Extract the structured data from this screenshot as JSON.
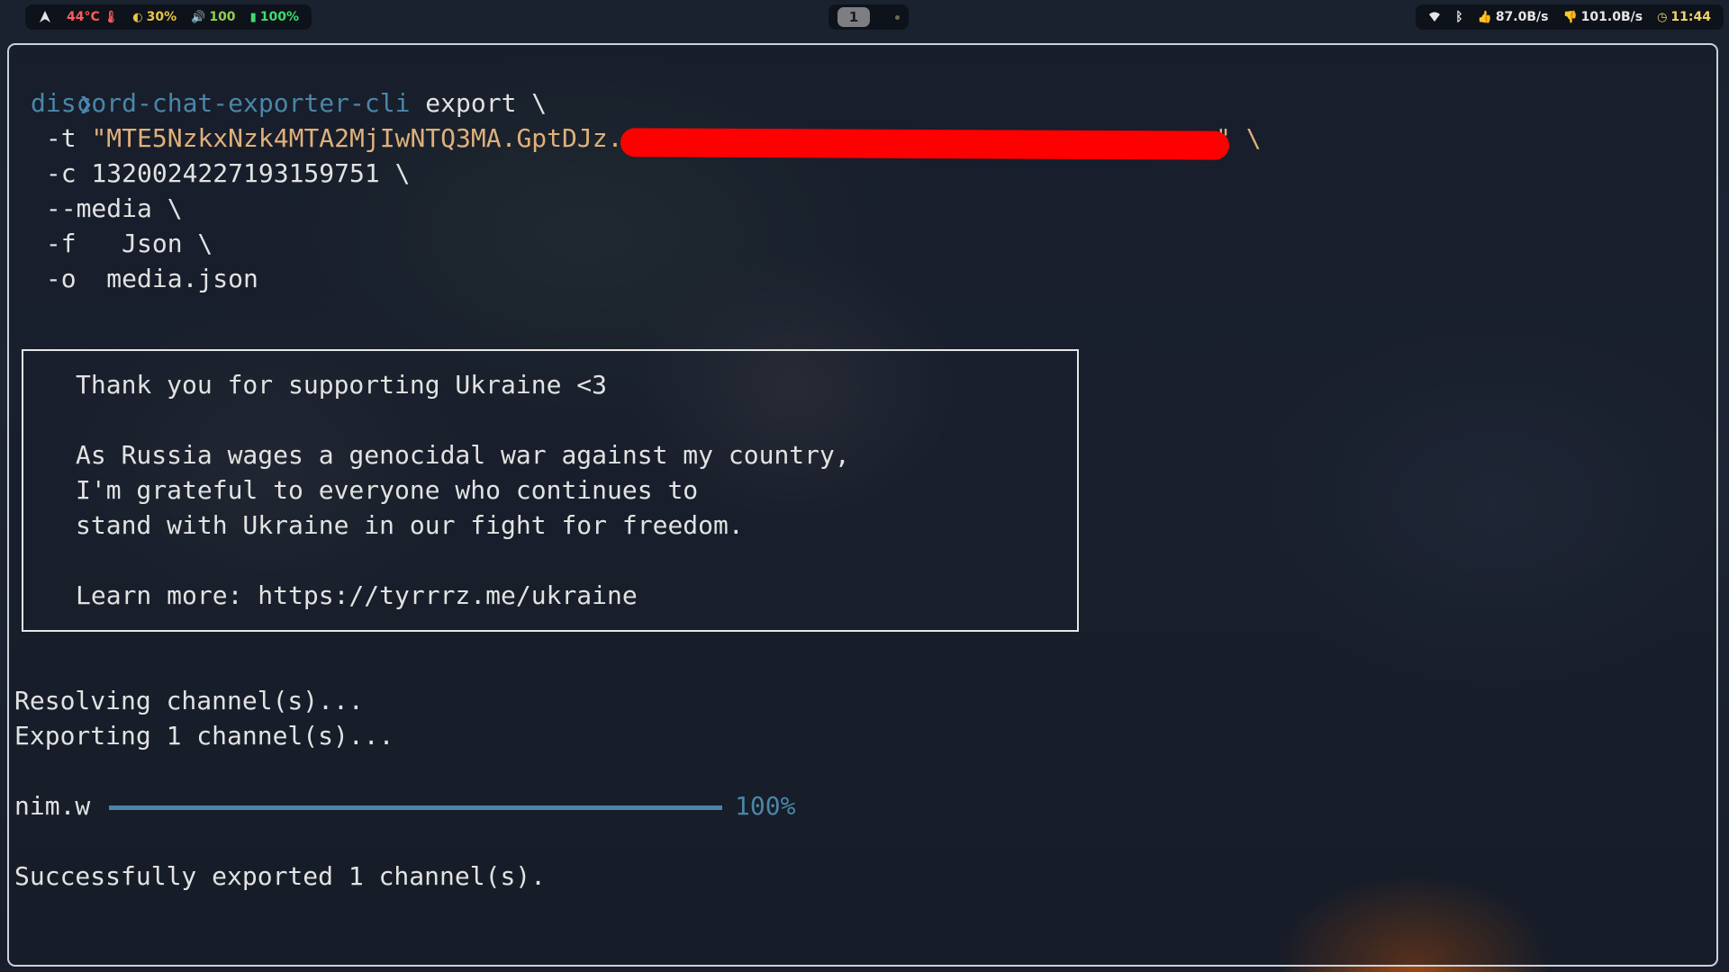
{
  "statusbar": {
    "left": {
      "arch_icon": "arch-logo-icon",
      "temp_text": "44°C",
      "temp_icon": "thermometer-icon",
      "temp_color": "#ff5c5c",
      "cpu_text": "30%",
      "cpu_icon": "cpu-icon",
      "cpu_color": "#e8c547",
      "volume_text": "100",
      "volume_icon": "volume-icon",
      "volume_color": "#8fd14f",
      "battery_text": "100%",
      "battery_icon": "battery-icon",
      "battery_color": "#3fdc6f"
    },
    "center": {
      "workspace": "1"
    },
    "right": {
      "wifi_icon": "wifi-icon",
      "bluetooth_icon": "bluetooth-icon",
      "upload_text": "87.0B/s",
      "upload_icon": "thumbs-up-icon",
      "download_text": "101.0B/s",
      "download_icon": "thumbs-down-icon",
      "clock_text": "11:44",
      "clock_icon": "clock-icon",
      "clock_color": "#f2d36b"
    }
  },
  "terminal": {
    "prompt": "❯",
    "command": {
      "program": "discord-chat-exporter-cli",
      "subcommand": " export \\",
      "token_flag": " -t ",
      "token_value": "\"MTE5NzkxNzk4MTA2MjIwNTQ3MA.GptDJz.",
      "token_end": "\" \\",
      "channel_line": " -c 1320024227193159751 \\",
      "media_line": " --media \\",
      "format_line": " -f   Json \\",
      "output_line": " -o  media.json"
    },
    "notice": {
      "title": "Thank you for supporting Ukraine <3",
      "line1": "As Russia wages a genocidal war against my country,",
      "line2": "I'm grateful to everyone who continues to",
      "line3": "stand with Ukraine in our fight for freedom.",
      "learn_more": "Learn more: https://tyrrrz.me/ukraine"
    },
    "output": {
      "resolving": "Resolving channel(s)...",
      "exporting": "Exporting 1 channel(s)...",
      "channel_name": "nim.w",
      "progress": 1.0,
      "progress_text": "100%",
      "success": "Successfully exported 1 channel(s)."
    }
  }
}
